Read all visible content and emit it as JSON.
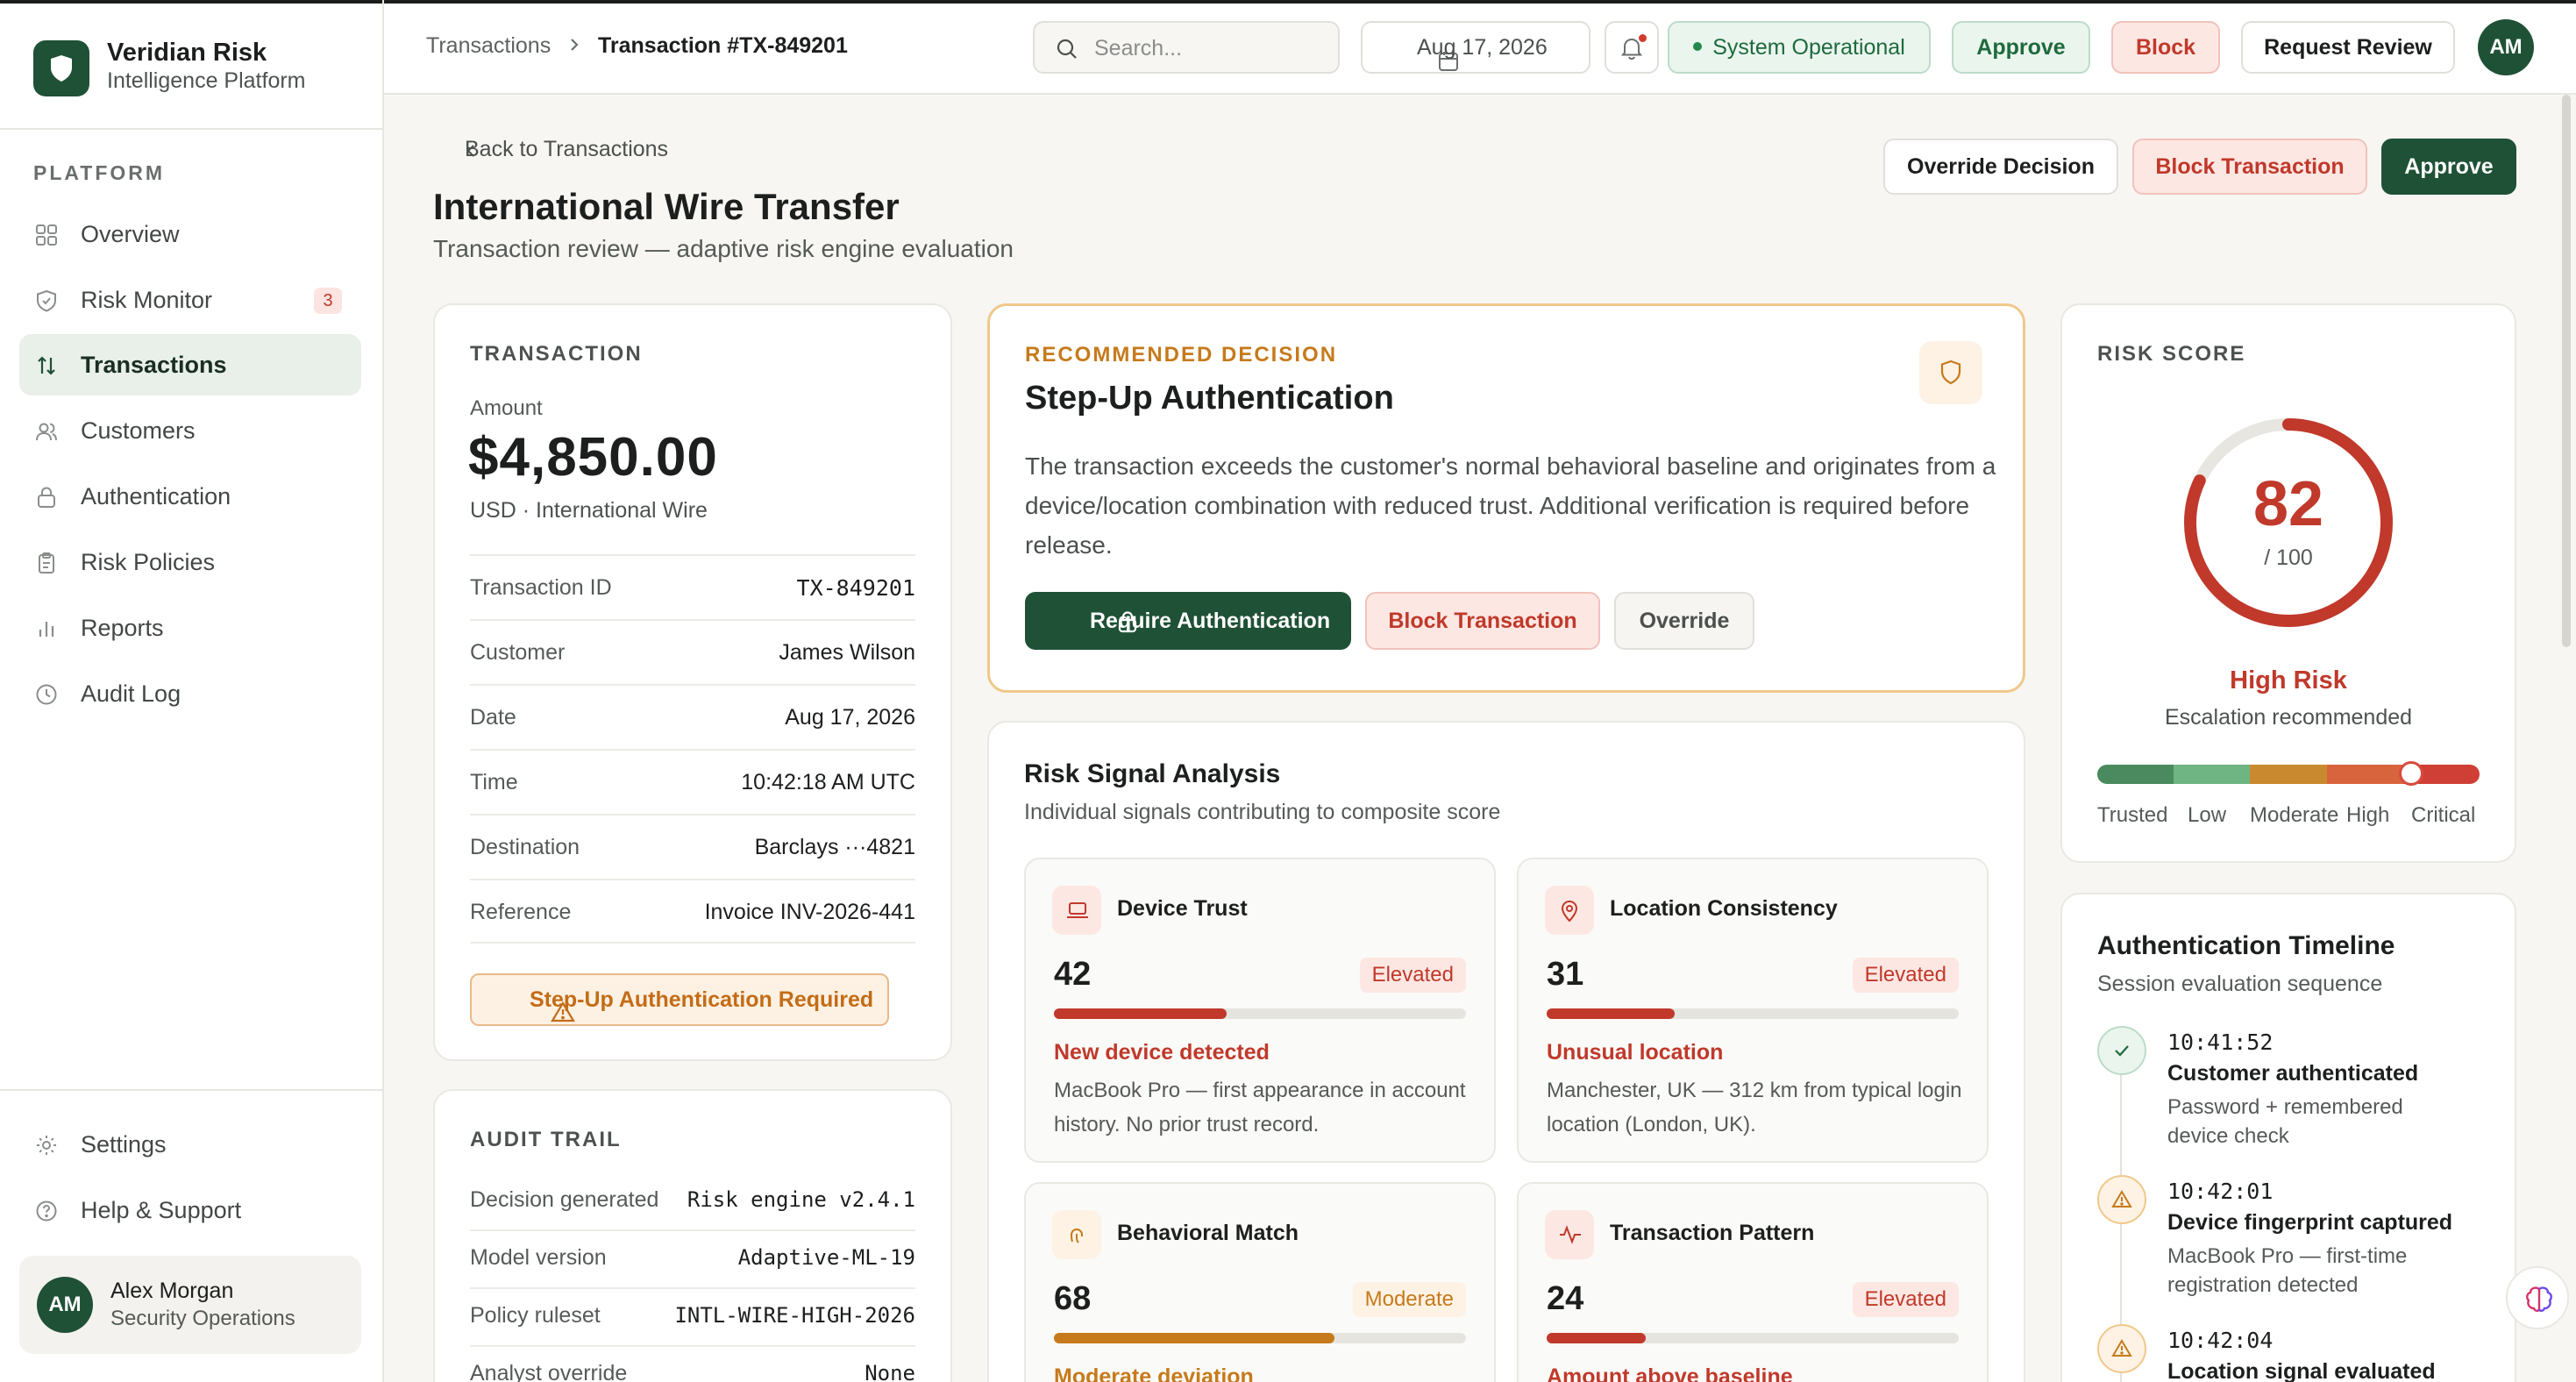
{
  "brand": {
    "name": "Veridian Risk",
    "subtitle": "Intelligence Platform"
  },
  "sidebar": {
    "section": "PLATFORM",
    "items": [
      {
        "label": "Overview",
        "icon": "grid-icon"
      },
      {
        "label": "Risk Monitor",
        "icon": "shield-icon",
        "badge": "3"
      },
      {
        "label": "Transactions",
        "icon": "arrows-up-down-icon",
        "active": true
      },
      {
        "label": "Customers",
        "icon": "users-icon"
      },
      {
        "label": "Authentication",
        "icon": "lock-icon"
      },
      {
        "label": "Risk Policies",
        "icon": "clipboard-icon"
      },
      {
        "label": "Reports",
        "icon": "bar-chart-icon"
      },
      {
        "label": "Audit Log",
        "icon": "clock-icon"
      }
    ],
    "footer": [
      {
        "label": "Settings",
        "icon": "gear-icon"
      },
      {
        "label": "Help & Support",
        "icon": "help-circle-icon"
      }
    ],
    "user": {
      "initials": "AM",
      "name": "Alex Morgan",
      "role": "Security Operations"
    }
  },
  "topbar": {
    "breadcrumb": [
      "Transactions",
      "Transaction #TX-849201"
    ],
    "search_placeholder": "Search...",
    "date": "Aug 17, 2026",
    "status": "System Operational",
    "approve": "Approve",
    "block": "Block",
    "request_review": "Request Review",
    "avatar": "AM"
  },
  "header": {
    "back": "Back to Transactions",
    "title": "International Wire Transfer",
    "subtitle": "Transaction review — adaptive risk engine evaluation",
    "actions": {
      "override": "Override Decision",
      "block": "Block Transaction",
      "approve": "Approve"
    }
  },
  "transaction": {
    "label": "TRANSACTION",
    "amount_label": "Amount",
    "amount": "$4,850.00",
    "amount_sub": "USD · International Wire",
    "fields": [
      {
        "k": "Transaction ID",
        "v": "TX-849201"
      },
      {
        "k": "Customer",
        "v": "James Wilson"
      },
      {
        "k": "Date",
        "v": "Aug 17, 2026"
      },
      {
        "k": "Time",
        "v": "10:42:18 AM UTC"
      },
      {
        "k": "Destination",
        "v": "Barclays ···4821"
      },
      {
        "k": "Reference",
        "v": "Invoice INV-2026-441"
      }
    ],
    "warning": "Step-Up Authentication Required"
  },
  "audit": {
    "label": "AUDIT TRAIL",
    "rows": [
      {
        "k": "Decision generated",
        "v": "Risk engine v2.4.1"
      },
      {
        "k": "Model version",
        "v": "Adaptive-ML-19"
      },
      {
        "k": "Policy ruleset",
        "v": "INTL-WIRE-HIGH-2026"
      },
      {
        "k": "Analyst override",
        "v": "None"
      }
    ]
  },
  "recommendation": {
    "label": "RECOMMENDED DECISION",
    "title": "Step-Up Authentication",
    "body": "The transaction exceeds the customer's normal behavioral baseline and originates from a device/location combination with reduced trust. Additional verification is required before release.",
    "buttons": {
      "require": "Require Authentication",
      "block": "Block Transaction",
      "override": "Override"
    }
  },
  "signals": {
    "title": "Risk Signal Analysis",
    "subtitle": "Individual signals contributing to composite score",
    "items": [
      {
        "name": "Device Trust",
        "score": "42",
        "level": "Elevated",
        "headline": "New device detected",
        "desc": "MacBook Pro — first appearance in account history. No prior trust record.",
        "icon": "laptop-icon",
        "color": "#c0392b",
        "fill": 0.42
      },
      {
        "name": "Location Consistency",
        "score": "31",
        "level": "Elevated",
        "headline": "Unusual location",
        "desc": "Manchester, UK — 312 km from typical login location (London, UK).",
        "icon": "map-pin-icon",
        "color": "#c0392b",
        "fill": 0.31
      },
      {
        "name": "Behavioral Match",
        "score": "68",
        "level": "Moderate",
        "headline": "Moderate deviation",
        "desc": "",
        "icon": "fingerprint-icon",
        "color": "#c67a1b",
        "fill": 0.68
      },
      {
        "name": "Transaction Pattern",
        "score": "24",
        "level": "Elevated",
        "headline": "Amount above baseline",
        "desc": "",
        "icon": "activity-icon",
        "color": "#c0392b",
        "fill": 0.24
      }
    ]
  },
  "risk_score": {
    "label": "RISK SCORE",
    "score": "82",
    "max": "/ 100",
    "value": 0.82,
    "level": "High Risk",
    "note": "Escalation recommended",
    "scale": [
      "Trusted",
      "Low",
      "Moderate",
      "High",
      "Critical"
    ],
    "scale_colors": [
      "#4a8a5e",
      "#6fb483",
      "#c98a2f",
      "#d8643e",
      "#cf3f35"
    ],
    "color": "#c0392b"
  },
  "timeline": {
    "title": "Authentication Timeline",
    "subtitle": "Session evaluation sequence",
    "events": [
      {
        "time": "10:41:52",
        "event": "Customer authenticated",
        "desc": "Password + remembered device check",
        "status": "ok"
      },
      {
        "time": "10:42:01",
        "event": "Device fingerprint captured",
        "desc": "MacBook Pro — first-time registration detected",
        "status": "warn"
      },
      {
        "time": "10:42:04",
        "event": "Location signal evaluated",
        "desc": "",
        "status": "warn"
      }
    ]
  }
}
